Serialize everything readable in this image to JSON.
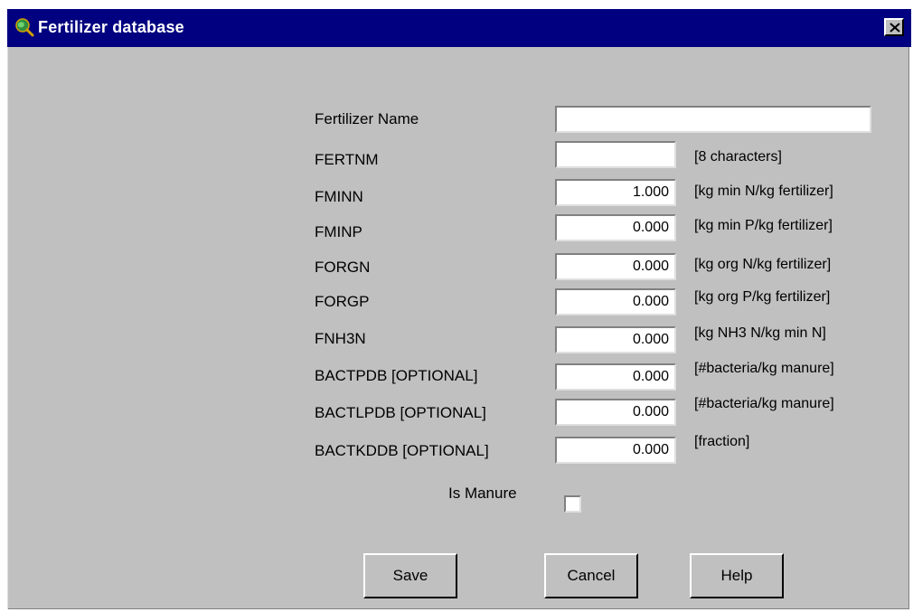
{
  "window": {
    "title": "Fertilizer database",
    "close_label": "close"
  },
  "form": {
    "fertilizer_name": {
      "label": "Fertilizer Name",
      "value": ""
    },
    "rows": [
      {
        "label": "FERTNM",
        "value": "",
        "unit": "[8 characters]"
      },
      {
        "label": "FMINN",
        "value": "1.000",
        "unit": "[kg min N/kg fertilizer]"
      },
      {
        "label": "FMINP",
        "value": "0.000",
        "unit": "[kg min P/kg fertilizer]"
      },
      {
        "label": "FORGN",
        "value": "0.000",
        "unit": "[kg org N/kg fertilizer]"
      },
      {
        "label": "FORGP",
        "value": "0.000",
        "unit": "[kg org P/kg fertilizer]"
      },
      {
        "label": "FNH3N",
        "value": "0.000",
        "unit": "[kg NH3  N/kg min N]"
      },
      {
        "label": "BACTPDB [OPTIONAL]",
        "value": "0.000",
        "unit": "[#bacteria/kg manure]"
      },
      {
        "label": "BACTLPDB [OPTIONAL]",
        "value": "0.000",
        "unit": "[#bacteria/kg manure]"
      },
      {
        "label": "BACTKDDB [OPTIONAL]",
        "value": "0.000",
        "unit": "[fraction]"
      }
    ],
    "is_manure": {
      "label": "Is Manure",
      "checked": false
    }
  },
  "buttons": {
    "save": "Save",
    "cancel": "Cancel",
    "help": "Help"
  },
  "icons": {
    "app": "globe-magnifier-icon",
    "close": "close-icon"
  },
  "colors": {
    "titlebar": "#000080",
    "window": "#c0c0c0"
  }
}
